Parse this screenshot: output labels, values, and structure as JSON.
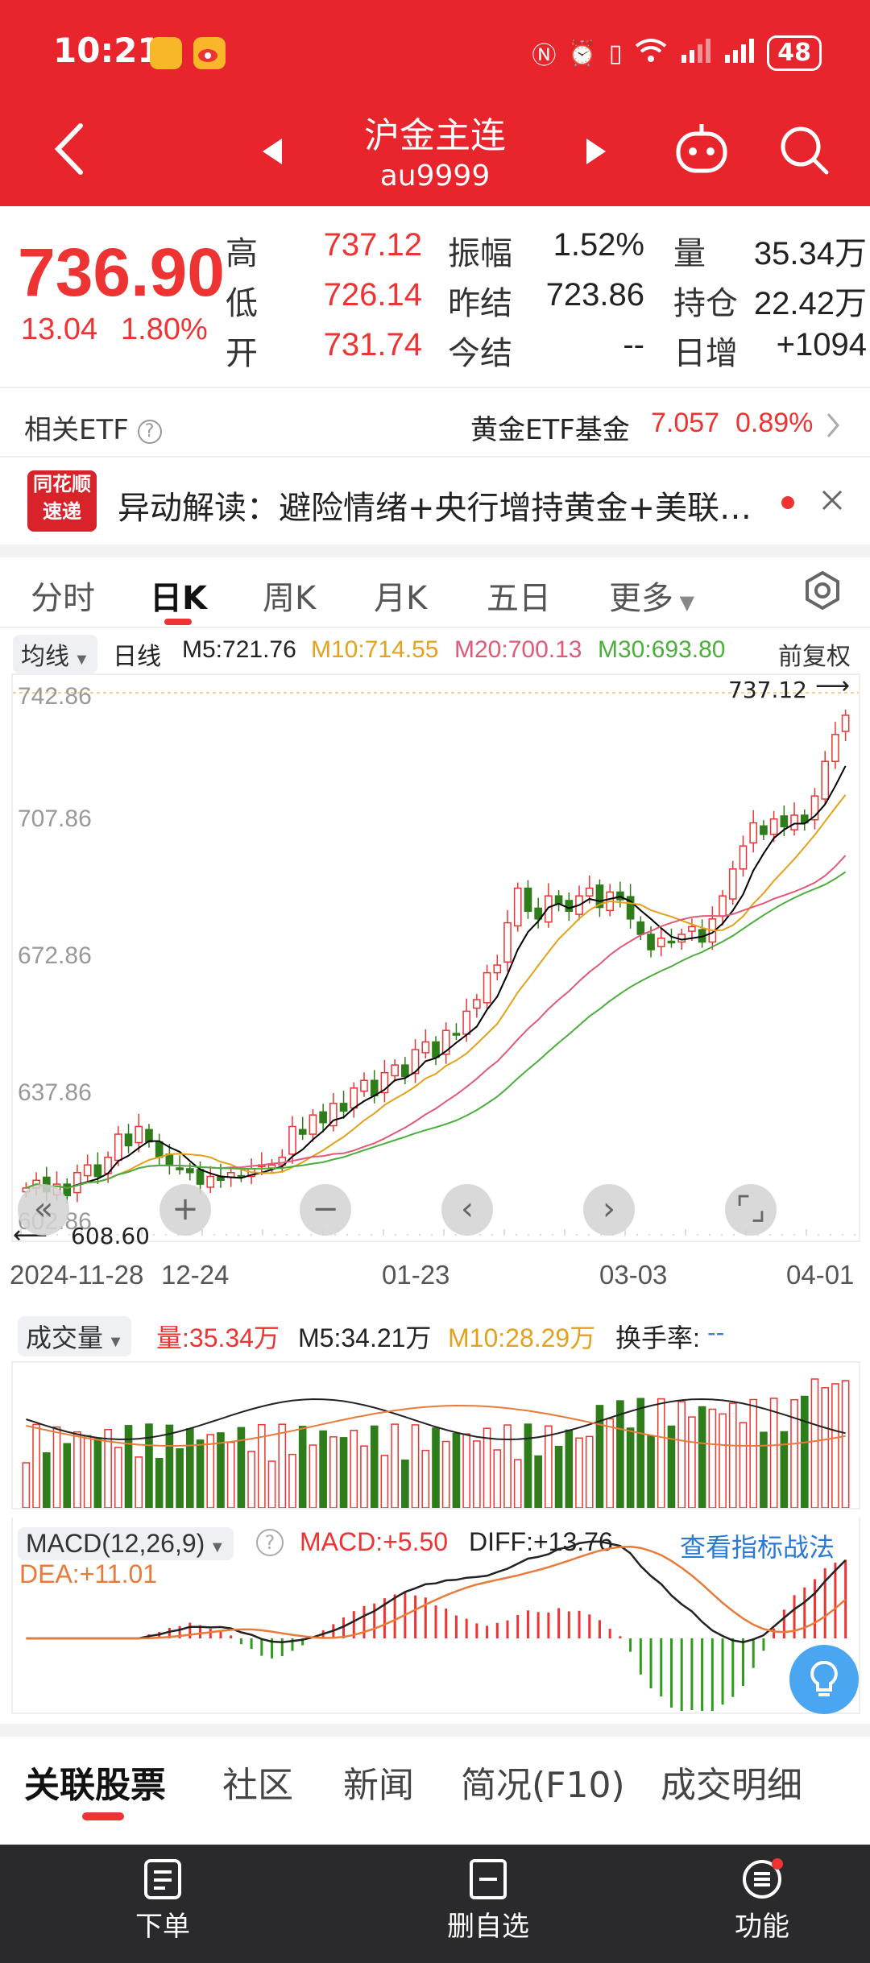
{
  "status_bar": {
    "time": "10:21",
    "battery": "48"
  },
  "header": {
    "title": "沪金主连",
    "code": "au9999"
  },
  "quote": {
    "price": "736.90",
    "change": "13.04",
    "change_pct": "1.80%",
    "fields": [
      {
        "label": "高",
        "value": "737.12",
        "color": "#e33"
      },
      {
        "label": "低",
        "value": "726.14",
        "color": "#e33"
      },
      {
        "label": "开",
        "value": "731.74",
        "color": "#e33"
      },
      {
        "label": "振幅",
        "value": "1.52%",
        "color": "#222"
      },
      {
        "label": "昨结",
        "value": "723.86",
        "color": "#222"
      },
      {
        "label": "今结",
        "value": "--",
        "color": "#222"
      },
      {
        "label": "量",
        "value": "35.34万",
        "color": "#222"
      },
      {
        "label": "持仓",
        "value": "22.42万",
        "color": "#222"
      },
      {
        "label": "日增",
        "value": "+1094",
        "color": "#222"
      }
    ]
  },
  "etf": {
    "label": "相关ETF",
    "name": "黄金ETF基金",
    "price": "7.057",
    "pct": "0.89%"
  },
  "news": {
    "logo_top": "同花顺",
    "logo_bottom": "速递",
    "text": "异动解读：避险情绪+央行增持黄金+美联储…"
  },
  "tabs": [
    "分时",
    "日K",
    "周K",
    "月K",
    "五日",
    "更多"
  ],
  "ma": {
    "selector": "均线",
    "period": "日线",
    "m5": "M5:721.76",
    "m10": "M10:714.55",
    "m20": "M20:700.13",
    "m30": "M30:693.80",
    "adjust": "前复权",
    "colors": {
      "m5": "#000000",
      "m10": "#e4a11b",
      "m20": "#e05a78",
      "m30": "#4cae3c"
    }
  },
  "kline": {
    "y_ticks": [
      "742.86",
      "707.86",
      "672.86",
      "637.86",
      "602.86"
    ],
    "max_label": "737.12",
    "min_label": "608.60",
    "dates": [
      "2024-11-28",
      "12-24",
      "01-23",
      "03-03",
      "04-01"
    ]
  },
  "volume": {
    "selector": "成交量",
    "vol": "量:35.34万",
    "m5": "M5:34.21万",
    "m10": "M10:28.29万",
    "turnover_label": "换手率:",
    "turnover_value": "--"
  },
  "macd": {
    "selector": "MACD(12,26,9)",
    "macd": "MACD:+5.50",
    "diff": "DIFF:+13.76",
    "dea": "DEA:+11.01",
    "link": "查看指标战法"
  },
  "bottom_tabs": [
    "关联股票",
    "社区",
    "新闻",
    "简况(F10)",
    "成交明细"
  ],
  "bottom_bar": [
    {
      "label": "下单",
      "icon": "order-icon"
    },
    {
      "label": "删自选",
      "icon": "remove-watchlist-icon"
    },
    {
      "label": "功能",
      "icon": "menu-icon"
    }
  ],
  "chart_data": {
    "type": "candlestick",
    "xlabel": "",
    "ylabel": "",
    "ylim": [
      602.86,
      742.86
    ],
    "x_ticks": [
      "2024-11-28",
      "12-24",
      "01-23",
      "03-03",
      "04-01"
    ],
    "close_series_approx": [
      614,
      616,
      613,
      615,
      612,
      618,
      620,
      617,
      622,
      628,
      625,
      630,
      626,
      622,
      620,
      619,
      618,
      615,
      617,
      616,
      618,
      617,
      619,
      620,
      620,
      622,
      630,
      628,
      633,
      631,
      636,
      634,
      640,
      642,
      638,
      644,
      646,
      643,
      650,
      652,
      648,
      655,
      654,
      660,
      663,
      670,
      672,
      683,
      692,
      686,
      684,
      690,
      688,
      686,
      690,
      692,
      687,
      691,
      689,
      684,
      680,
      676,
      679,
      678,
      680,
      682,
      678,
      684,
      690,
      697,
      703,
      709,
      706,
      710,
      708,
      711,
      709,
      716,
      725,
      732,
      737
    ]
  }
}
